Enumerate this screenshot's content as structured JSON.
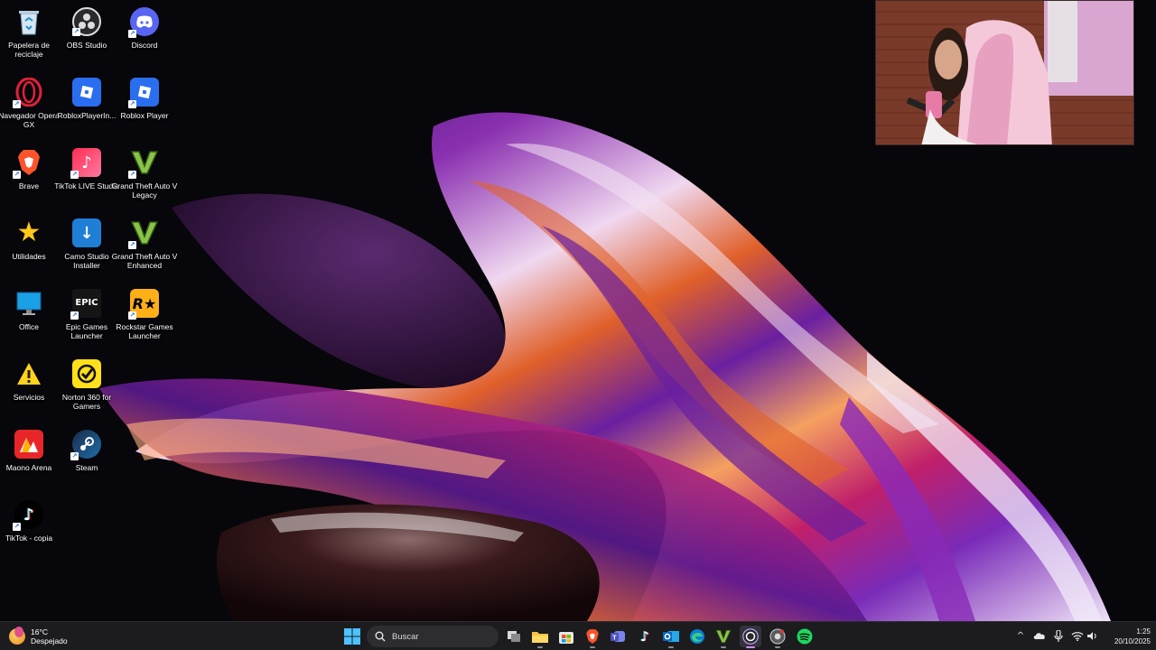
{
  "desktop": {
    "icons": [
      {
        "label": "Papelera de reciclaje",
        "icon": "recycle-bin-icon"
      },
      {
        "label": "OBS Studio",
        "icon": "obs-icon"
      },
      {
        "label": "Discord",
        "icon": "discord-icon"
      },
      {
        "label": "Navegador Opera GX",
        "icon": "opera-gx-icon"
      },
      {
        "label": "RobloxPlayerIn...",
        "icon": "roblox-icon"
      },
      {
        "label": "Roblox Player",
        "icon": "roblox-icon"
      },
      {
        "label": "Brave",
        "icon": "brave-icon"
      },
      {
        "label": "TikTok LIVE Studio",
        "icon": "tiktok-live-icon"
      },
      {
        "label": "Grand Theft Auto V Legacy",
        "icon": "gta-icon"
      },
      {
        "label": "Utilidades",
        "icon": "star-folder-icon"
      },
      {
        "label": "Camo Studio Installer",
        "icon": "camo-installer-icon"
      },
      {
        "label": "Grand Theft Auto V Enhanced",
        "icon": "gta-icon"
      },
      {
        "label": "Office",
        "icon": "office-icon"
      },
      {
        "label": "Epic Games Launcher",
        "icon": "epic-games-icon"
      },
      {
        "label": "Rockstar Games Launcher",
        "icon": "rockstar-icon"
      },
      {
        "label": "Servicios",
        "icon": "warning-icon"
      },
      {
        "label": "Norton 360 for Gamers",
        "icon": "norton-icon"
      },
      {
        "label": "Maono Arena",
        "icon": "maono-icon"
      },
      {
        "label": "Steam",
        "icon": "steam-icon"
      },
      {
        "label": "TikTok - copia",
        "icon": "tiktok-icon"
      }
    ]
  },
  "taskbar": {
    "weather": {
      "temp": "16°C",
      "condition": "Despejado"
    },
    "search": {
      "placeholder": "Buscar"
    },
    "apps": [
      "task-view-icon",
      "file-explorer-icon",
      "microsoft-store-icon",
      "brave-icon",
      "teams-icon",
      "tiktok-icon",
      "outlook-icon",
      "edge-icon",
      "gta-icon",
      "obs-icon",
      "chrome-icon",
      "spotify-icon"
    ],
    "tray": [
      "chevron-up-icon",
      "onedrive-icon",
      "microphone-icon",
      "wifi-icon",
      "speaker-icon"
    ],
    "clock": {
      "time": "1:25",
      "date": "20/10/2025"
    }
  },
  "colors": {
    "taskbar": "#1c1c1f",
    "accent": "#d08ae8"
  }
}
